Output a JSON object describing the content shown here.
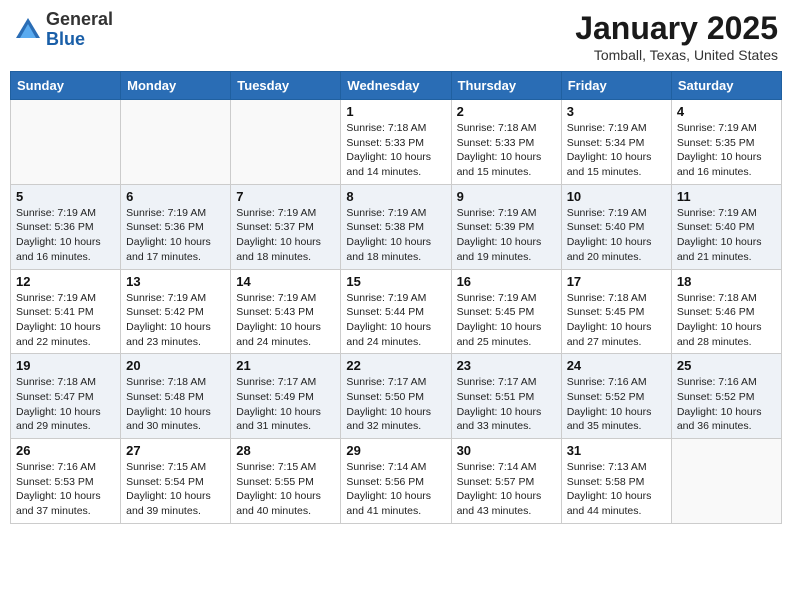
{
  "header": {
    "logo_general": "General",
    "logo_blue": "Blue",
    "month": "January 2025",
    "location": "Tomball, Texas, United States"
  },
  "weekdays": [
    "Sunday",
    "Monday",
    "Tuesday",
    "Wednesday",
    "Thursday",
    "Friday",
    "Saturday"
  ],
  "weeks": [
    [
      {
        "day": "",
        "sunrise": "",
        "sunset": "",
        "daylight": ""
      },
      {
        "day": "",
        "sunrise": "",
        "sunset": "",
        "daylight": ""
      },
      {
        "day": "",
        "sunrise": "",
        "sunset": "",
        "daylight": ""
      },
      {
        "day": "1",
        "sunrise": "Sunrise: 7:18 AM",
        "sunset": "Sunset: 5:33 PM",
        "daylight": "Daylight: 10 hours and 14 minutes."
      },
      {
        "day": "2",
        "sunrise": "Sunrise: 7:18 AM",
        "sunset": "Sunset: 5:33 PM",
        "daylight": "Daylight: 10 hours and 15 minutes."
      },
      {
        "day": "3",
        "sunrise": "Sunrise: 7:19 AM",
        "sunset": "Sunset: 5:34 PM",
        "daylight": "Daylight: 10 hours and 15 minutes."
      },
      {
        "day": "4",
        "sunrise": "Sunrise: 7:19 AM",
        "sunset": "Sunset: 5:35 PM",
        "daylight": "Daylight: 10 hours and 16 minutes."
      }
    ],
    [
      {
        "day": "5",
        "sunrise": "Sunrise: 7:19 AM",
        "sunset": "Sunset: 5:36 PM",
        "daylight": "Daylight: 10 hours and 16 minutes."
      },
      {
        "day": "6",
        "sunrise": "Sunrise: 7:19 AM",
        "sunset": "Sunset: 5:36 PM",
        "daylight": "Daylight: 10 hours and 17 minutes."
      },
      {
        "day": "7",
        "sunrise": "Sunrise: 7:19 AM",
        "sunset": "Sunset: 5:37 PM",
        "daylight": "Daylight: 10 hours and 18 minutes."
      },
      {
        "day": "8",
        "sunrise": "Sunrise: 7:19 AM",
        "sunset": "Sunset: 5:38 PM",
        "daylight": "Daylight: 10 hours and 18 minutes."
      },
      {
        "day": "9",
        "sunrise": "Sunrise: 7:19 AM",
        "sunset": "Sunset: 5:39 PM",
        "daylight": "Daylight: 10 hours and 19 minutes."
      },
      {
        "day": "10",
        "sunrise": "Sunrise: 7:19 AM",
        "sunset": "Sunset: 5:40 PM",
        "daylight": "Daylight: 10 hours and 20 minutes."
      },
      {
        "day": "11",
        "sunrise": "Sunrise: 7:19 AM",
        "sunset": "Sunset: 5:40 PM",
        "daylight": "Daylight: 10 hours and 21 minutes."
      }
    ],
    [
      {
        "day": "12",
        "sunrise": "Sunrise: 7:19 AM",
        "sunset": "Sunset: 5:41 PM",
        "daylight": "Daylight: 10 hours and 22 minutes."
      },
      {
        "day": "13",
        "sunrise": "Sunrise: 7:19 AM",
        "sunset": "Sunset: 5:42 PM",
        "daylight": "Daylight: 10 hours and 23 minutes."
      },
      {
        "day": "14",
        "sunrise": "Sunrise: 7:19 AM",
        "sunset": "Sunset: 5:43 PM",
        "daylight": "Daylight: 10 hours and 24 minutes."
      },
      {
        "day": "15",
        "sunrise": "Sunrise: 7:19 AM",
        "sunset": "Sunset: 5:44 PM",
        "daylight": "Daylight: 10 hours and 24 minutes."
      },
      {
        "day": "16",
        "sunrise": "Sunrise: 7:19 AM",
        "sunset": "Sunset: 5:45 PM",
        "daylight": "Daylight: 10 hours and 25 minutes."
      },
      {
        "day": "17",
        "sunrise": "Sunrise: 7:18 AM",
        "sunset": "Sunset: 5:45 PM",
        "daylight": "Daylight: 10 hours and 27 minutes."
      },
      {
        "day": "18",
        "sunrise": "Sunrise: 7:18 AM",
        "sunset": "Sunset: 5:46 PM",
        "daylight": "Daylight: 10 hours and 28 minutes."
      }
    ],
    [
      {
        "day": "19",
        "sunrise": "Sunrise: 7:18 AM",
        "sunset": "Sunset: 5:47 PM",
        "daylight": "Daylight: 10 hours and 29 minutes."
      },
      {
        "day": "20",
        "sunrise": "Sunrise: 7:18 AM",
        "sunset": "Sunset: 5:48 PM",
        "daylight": "Daylight: 10 hours and 30 minutes."
      },
      {
        "day": "21",
        "sunrise": "Sunrise: 7:17 AM",
        "sunset": "Sunset: 5:49 PM",
        "daylight": "Daylight: 10 hours and 31 minutes."
      },
      {
        "day": "22",
        "sunrise": "Sunrise: 7:17 AM",
        "sunset": "Sunset: 5:50 PM",
        "daylight": "Daylight: 10 hours and 32 minutes."
      },
      {
        "day": "23",
        "sunrise": "Sunrise: 7:17 AM",
        "sunset": "Sunset: 5:51 PM",
        "daylight": "Daylight: 10 hours and 33 minutes."
      },
      {
        "day": "24",
        "sunrise": "Sunrise: 7:16 AM",
        "sunset": "Sunset: 5:52 PM",
        "daylight": "Daylight: 10 hours and 35 minutes."
      },
      {
        "day": "25",
        "sunrise": "Sunrise: 7:16 AM",
        "sunset": "Sunset: 5:52 PM",
        "daylight": "Daylight: 10 hours and 36 minutes."
      }
    ],
    [
      {
        "day": "26",
        "sunrise": "Sunrise: 7:16 AM",
        "sunset": "Sunset: 5:53 PM",
        "daylight": "Daylight: 10 hours and 37 minutes."
      },
      {
        "day": "27",
        "sunrise": "Sunrise: 7:15 AM",
        "sunset": "Sunset: 5:54 PM",
        "daylight": "Daylight: 10 hours and 39 minutes."
      },
      {
        "day": "28",
        "sunrise": "Sunrise: 7:15 AM",
        "sunset": "Sunset: 5:55 PM",
        "daylight": "Daylight: 10 hours and 40 minutes."
      },
      {
        "day": "29",
        "sunrise": "Sunrise: 7:14 AM",
        "sunset": "Sunset: 5:56 PM",
        "daylight": "Daylight: 10 hours and 41 minutes."
      },
      {
        "day": "30",
        "sunrise": "Sunrise: 7:14 AM",
        "sunset": "Sunset: 5:57 PM",
        "daylight": "Daylight: 10 hours and 43 minutes."
      },
      {
        "day": "31",
        "sunrise": "Sunrise: 7:13 AM",
        "sunset": "Sunset: 5:58 PM",
        "daylight": "Daylight: 10 hours and 44 minutes."
      },
      {
        "day": "",
        "sunrise": "",
        "sunset": "",
        "daylight": ""
      }
    ]
  ]
}
